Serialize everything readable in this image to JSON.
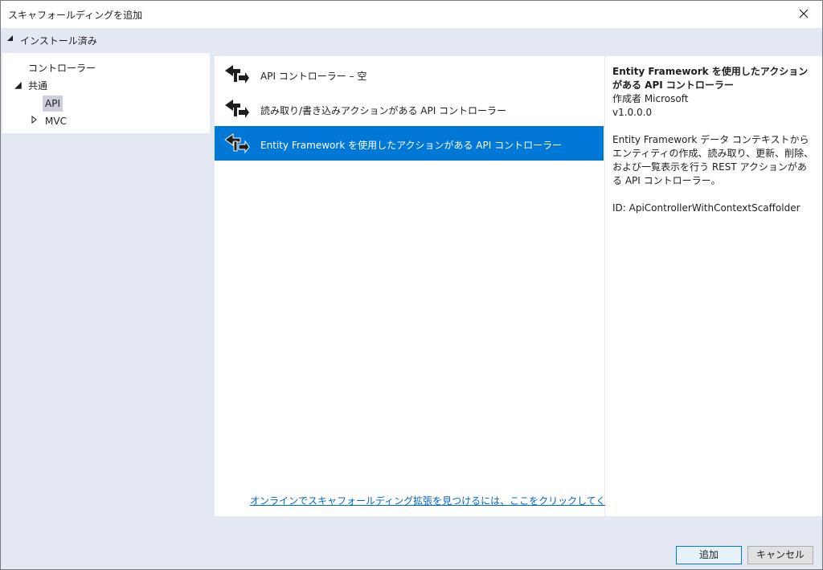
{
  "window": {
    "title": "スキャフォールディングを追加",
    "close_icon": "close-icon"
  },
  "installed": {
    "label": "インストール済み",
    "expanded": true
  },
  "tree": {
    "items": [
      {
        "label": "コントローラー"
      },
      {
        "label": "共通",
        "expanded": true
      },
      {
        "label": "API",
        "selected": true
      },
      {
        "label": "MVC",
        "expanded": false
      }
    ]
  },
  "templates": {
    "items": [
      {
        "label": "API コントローラー – 空",
        "icon": "controller-icon"
      },
      {
        "label": "読み取り/書き込みアクションがある API コントローラー",
        "icon": "controller-icon"
      },
      {
        "label": "Entity Framework を使用したアクションがある API コントローラー",
        "icon": "controller-icon",
        "selected": true
      }
    ],
    "online_link": "オンラインでスキャフォールディング拡張を見つけるには、ここをクリックしてください。"
  },
  "details": {
    "title": "Entity Framework を使用したアクションがある API コントローラー",
    "author": "作成者 Microsoft",
    "version": "v1.0.0.0",
    "description": "Entity Framework データ コンテキストからエンティティの作成、読み取り、更新、削除、および一覧表示を行う REST アクションがある API コントローラー。",
    "id": "ID: ApiControllerWithContextScaffolder"
  },
  "buttons": {
    "add": "追加",
    "cancel": "キャンセル"
  },
  "colors": {
    "selection": "#0078d7",
    "panel_bg": "#e3e8f3",
    "link": "#0066cc"
  }
}
